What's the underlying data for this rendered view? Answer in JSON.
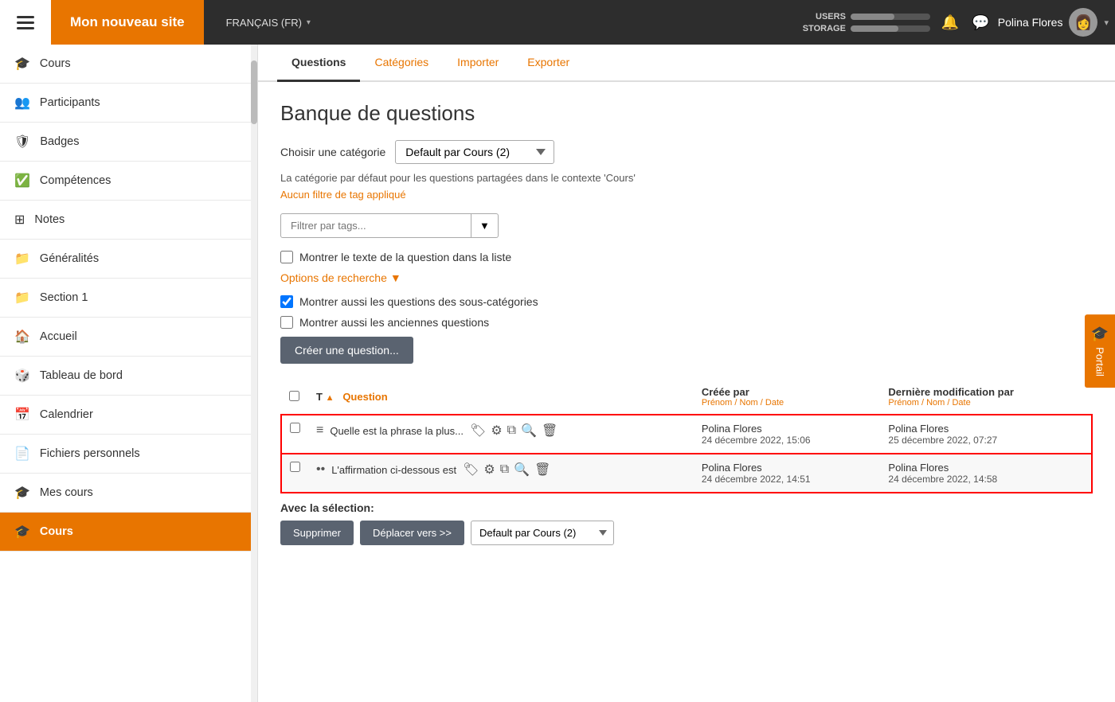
{
  "topnav": {
    "hamburger_label": "Menu",
    "site_name": "Mon nouveau site",
    "language": "FRANÇAIS (FR)",
    "users_label": "USERS",
    "storage_label": "STORAGE",
    "users_fill_pct": 55,
    "storage_fill_pct": 60,
    "user_name": "Polina Flores",
    "dropdown_arrow": "▾",
    "bell_icon": "🔔",
    "chat_icon": "💬"
  },
  "sidebar": {
    "items": [
      {
        "id": "cours-top",
        "icon": "🎓",
        "label": "Cours"
      },
      {
        "id": "participants",
        "icon": "👥",
        "label": "Participants"
      },
      {
        "id": "badges",
        "icon": "🛡",
        "label": "Badges"
      },
      {
        "id": "competences",
        "icon": "✅",
        "label": "Compétences"
      },
      {
        "id": "notes",
        "icon": "⊞",
        "label": "Notes"
      },
      {
        "id": "generalites",
        "icon": "📁",
        "label": "Généralités"
      },
      {
        "id": "section1",
        "icon": "📁",
        "label": "Section 1"
      },
      {
        "id": "accueil",
        "icon": "🏠",
        "label": "Accueil"
      },
      {
        "id": "tableau-de-bord",
        "icon": "🎲",
        "label": "Tableau de bord"
      },
      {
        "id": "calendrier",
        "icon": "📅",
        "label": "Calendrier"
      },
      {
        "id": "fichiers-personnels",
        "icon": "📄",
        "label": "Fichiers personnels"
      },
      {
        "id": "mes-cours",
        "icon": "🎓",
        "label": "Mes cours"
      },
      {
        "id": "cours-active",
        "icon": "🎓",
        "label": "Cours",
        "active": true
      }
    ]
  },
  "tabs": [
    {
      "id": "questions",
      "label": "Questions",
      "active": true
    },
    {
      "id": "categories",
      "label": "Catégories"
    },
    {
      "id": "importer",
      "label": "Importer"
    },
    {
      "id": "exporter",
      "label": "Exporter"
    }
  ],
  "page": {
    "title": "Banque de questions",
    "category_label": "Choisir une catégorie",
    "category_value": "Default par Cours (2)",
    "category_desc": "La catégorie par défaut pour les questions partagées dans le contexte 'Cours'",
    "no_filter_label": "Aucun filtre de tag appliqué",
    "filter_placeholder": "Filtrer par tags...",
    "show_question_text_label": "Montrer le texte de la question dans la liste",
    "search_options_label": "Options de recherche",
    "show_subcategories_label": "Montrer aussi les questions des sous-catégories",
    "show_old_label": "Montrer aussi les anciennes questions",
    "create_btn_label": "Créer une question...",
    "table": {
      "col_type": "T",
      "col_type_sort": "▲",
      "col_question": "Question",
      "col_created": "Créée par",
      "col_sub_created": "Prénom / Nom / Date",
      "col_modified": "Dernière modification par",
      "col_sub_modified": "Prénom / Nom / Date",
      "rows": [
        {
          "id": "row1",
          "type_icon": "≡",
          "question_text": "Quelle est la phrase la plus...",
          "created_by": "Polina Flores",
          "created_date": "24 décembre 2022, 15:06",
          "modified_by": "Polina Flores",
          "modified_date": "25 décembre 2022, 07:27"
        },
        {
          "id": "row2",
          "type_icon": "•",
          "question_text": "L'affirmation ci-dessous est",
          "created_by": "Polina Flores",
          "created_date": "24 décembre 2022, 14:51",
          "modified_by": "Polina Flores",
          "modified_date": "24 décembre 2022, 14:58"
        }
      ]
    },
    "avec_label": "Avec la sélection:",
    "supprimer_label": "Supprimer",
    "deplacer_label": "Déplacer vers >>",
    "deplacer_category": "Default par Cours (2)"
  },
  "portal": {
    "label": "Portail"
  }
}
